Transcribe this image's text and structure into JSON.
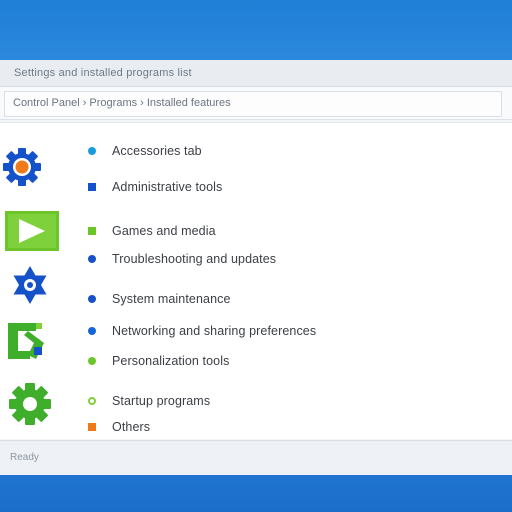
{
  "window": {
    "title": "Settings and installed programs list",
    "address": "Control Panel › Programs › Installed features",
    "status": "Ready"
  },
  "list": [
    {
      "name": "list-item-1",
      "label": "Accessories tab",
      "bullet_color": "#1a9be0",
      "bullet_shape": "round"
    },
    {
      "name": "list-item-2",
      "label": "Administrative tools",
      "bullet_color": "#1552c9",
      "bullet_shape": "square"
    },
    {
      "name": "list-item-3",
      "label": "Games and media",
      "bullet_color": "#6cc62a",
      "bullet_shape": "square"
    },
    {
      "name": "list-item-4",
      "label": "Troubleshooting and updates",
      "bullet_color": "#1552c9",
      "bullet_shape": "round"
    },
    {
      "name": "list-item-5",
      "label": "System maintenance",
      "bullet_color": "#1552c9",
      "bullet_shape": "round"
    },
    {
      "name": "list-item-6",
      "label": "Networking and sharing preferences",
      "bullet_color": "#1565d8",
      "bullet_shape": "round"
    },
    {
      "name": "list-item-7",
      "label": "Personalization tools",
      "bullet_color": "#6cc62a",
      "bullet_shape": "round"
    },
    {
      "name": "list-item-8",
      "label": "Startup programs",
      "bullet_color": "#7fd13b",
      "bullet_shape": "ring"
    },
    {
      "name": "list-item-9",
      "label": "Others",
      "bullet_color": "#f07a1a",
      "bullet_shape": "square"
    }
  ],
  "icons": {
    "gear": "gear-icon",
    "play": "play-icon",
    "star": "star-icon",
    "terminal": "terminal-icon",
    "cog": "cog-icon"
  },
  "colors": {
    "blue": "#1552c9",
    "green": "#6cc62a",
    "orange": "#f07a1a",
    "desktop": "#2f86de"
  }
}
